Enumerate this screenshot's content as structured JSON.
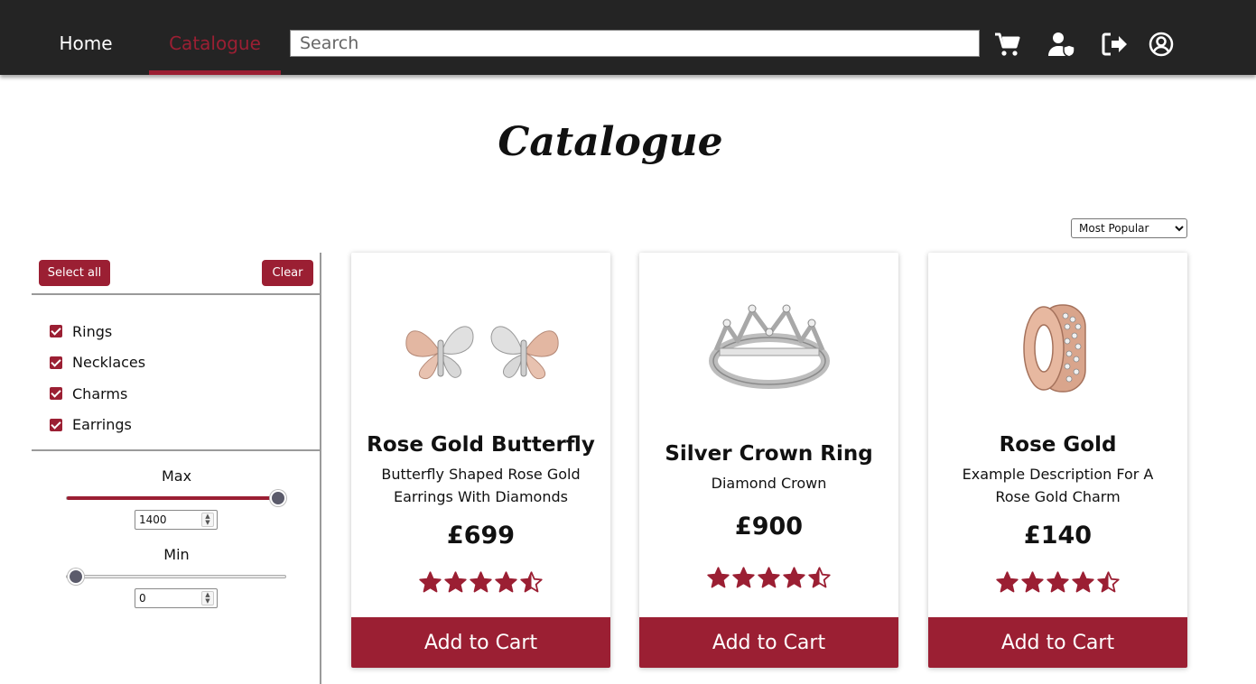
{
  "nav": {
    "home": "Home",
    "catalogue": "Catalogue",
    "search_placeholder": "Search",
    "icons": [
      "cart-icon",
      "user-shield-icon",
      "logout-icon",
      "account-icon"
    ]
  },
  "page": {
    "title": "Catalogue"
  },
  "sort": {
    "selected": "Most Popular"
  },
  "filters": {
    "select_all": "Select all",
    "clear": "Clear",
    "categories": [
      "Rings",
      "Necklaces",
      "Charms",
      "Earrings"
    ],
    "max": {
      "label": "Max",
      "value": "1400"
    },
    "min": {
      "label": "Min",
      "value": "0"
    }
  },
  "products": [
    {
      "title": "Rose Gold Butterfly",
      "desc": "Butterfly Shaped Rose Gold Earrings With Diamonds",
      "price": "£699",
      "rating": 4.5,
      "image": "butterfly-earrings-image",
      "button": "Add to Cart"
    },
    {
      "title": "Silver Crown Ring",
      "desc": "Diamond Crown",
      "price": "£900",
      "rating": 4.5,
      "image": "crown-ring-image",
      "button": "Add to Cart"
    },
    {
      "title": "Rose Gold",
      "desc": "Example Description For A Rose Gold Charm",
      "price": "£140",
      "rating": 4.5,
      "image": "rose-gold-charm-image",
      "button": "Add to Cart"
    }
  ],
  "colors": {
    "accent": "#9b1f33",
    "navbar": "#242424"
  }
}
